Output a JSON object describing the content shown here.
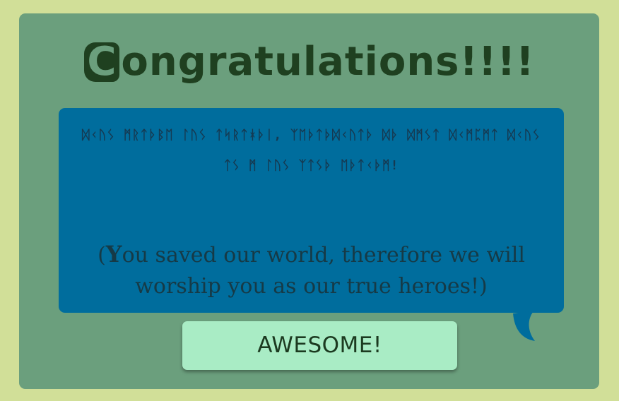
{
  "dialog": {
    "title_first_letter": "C",
    "title_rest": "ongratulations!!!!",
    "alien_text": "ᛞᚲᚢᛊ ᛗᚱᛏᚦᛒᛖ ᛚᚢᛊ ᛏᛋᚱᛏᚼᚦᛁ, ᛉᛖᚦᛏᚦᛞᚲᚢᛏᚦ ᛞᚦ ᛞᛗᛊᛏ ᛞᚲᛗᛈᛗᛏ ᛞᚲᚢᛊ ᛏᛊ ᛗ ᛚᚢᛊ ᛉᛏᛊᚦ ᛖᚦᛏᚲᚦᛗ!",
    "translation_open_paren": "(",
    "translation_first_letter": "Y",
    "translation_rest": "ou saved our world, therefore we will worship you as our true heroes!)",
    "button_label": "AWESOME!"
  },
  "colors": {
    "background": "#d1df98",
    "panel": "#6b9f7d",
    "bubble": "#006d9d",
    "button": "#a9ecc5",
    "title": "#1f4020"
  }
}
